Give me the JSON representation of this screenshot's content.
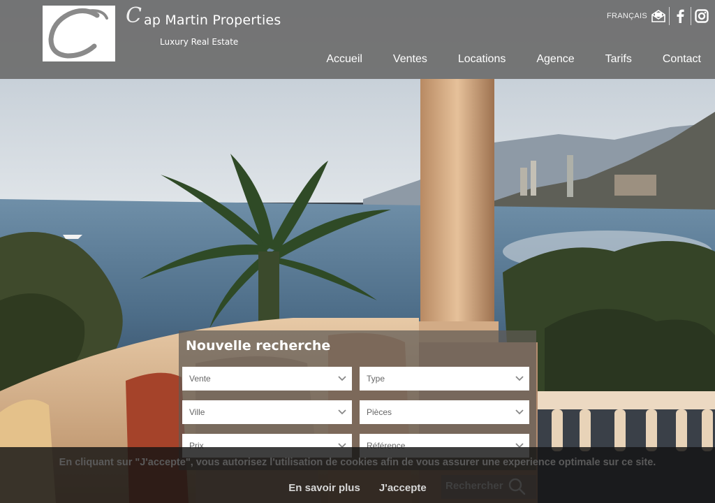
{
  "brand": {
    "name_rest": "ap Martin Properties",
    "name_initial": "C",
    "tagline": "Luxury Real Estate"
  },
  "header": {
    "language": "FRANÇAIS",
    "icons": [
      "envelope-icon",
      "facebook-icon",
      "instagram-icon"
    ],
    "nav": [
      "Accueil",
      "Ventes",
      "Locations",
      "Agence",
      "Tarifs",
      "Contact"
    ]
  },
  "search": {
    "title": "Nouvelle recherche",
    "fields": {
      "transaction": "Vente",
      "type": "Type",
      "city": "Ville",
      "rooms": "Pièces",
      "price": "Prix",
      "reference": "Référence"
    },
    "button_label": "Rechercher"
  },
  "cookie": {
    "text": "En cliquant sur \"J'accepte\", vous autorisez l'utilisation de cookies afin de vous assurer une experience optimale sur ce site.",
    "learn_more": "En savoir plus",
    "accept": "J'accepte"
  },
  "colors": {
    "header_bg": "#6e6e6e",
    "panel_bg": "#5f5a55",
    "cookie_bg": "#141414"
  }
}
